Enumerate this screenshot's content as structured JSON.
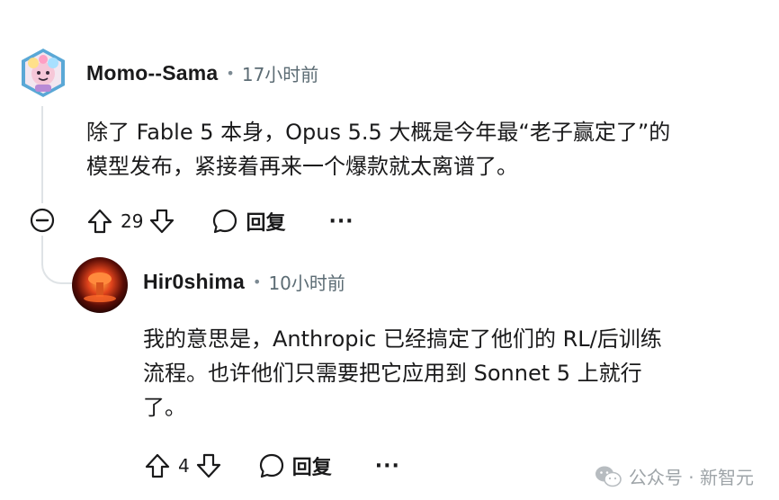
{
  "comments": [
    {
      "username": "Momo--Sama",
      "separator": "•",
      "time": "17小时前",
      "body_line1": "除了 Fable 5 本身，Opus 5.5 大概是今年最“老子赢定了”的",
      "body_line2": "模型发布，紧接着再来一个爆款就太离谱了。",
      "vote_count": "29",
      "reply_label": "回复",
      "more_label": "···"
    },
    {
      "username": "Hir0shima",
      "separator": "•",
      "time": "10小时前",
      "body_line1": "我的意思是，Anthropic 已经搞定了他们的 RL/后训练",
      "body_line2": "流程。也许他们只需要把它应用到 Sonnet 5 上就行",
      "body_line3": "了。",
      "vote_count": "4",
      "reply_label": "回复",
      "more_label": "···"
    }
  ],
  "watermark": {
    "text": "公众号 · 新智元",
    "icon": "wechat-icon"
  },
  "colors": {
    "text": "#1a1a1b",
    "meta": "#5c6c74",
    "thread_line": "#dfe3e6",
    "watermark": "#9ea4a8"
  },
  "icons": [
    "upvote-icon",
    "downvote-icon",
    "comment-icon",
    "collapse-icon",
    "more-icon"
  ]
}
